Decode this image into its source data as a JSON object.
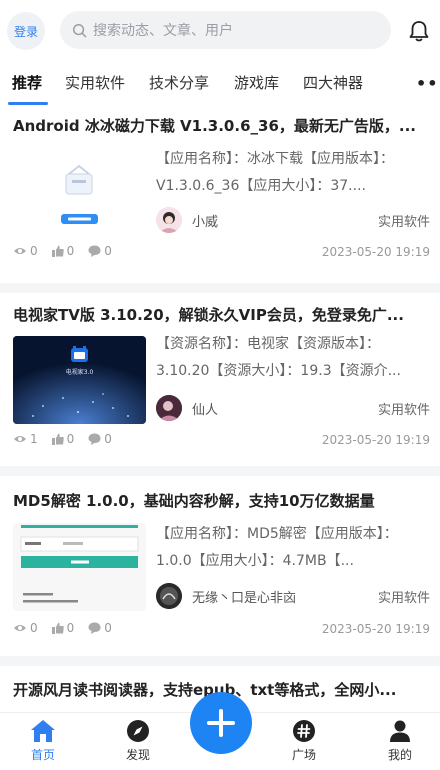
{
  "header": {
    "login_label": "登录",
    "search_placeholder": "搜索动态、文章、用户",
    "bell_icon": "bell-icon",
    "accent_color": "#2f7ff0"
  },
  "tabs": [
    {
      "label": "推荐",
      "active": true
    },
    {
      "label": "实用软件",
      "active": false
    },
    {
      "label": "技术分享",
      "active": false
    },
    {
      "label": "游戏库",
      "active": false
    },
    {
      "label": "四大神器",
      "active": false
    }
  ],
  "more_label": "•••",
  "posts": [
    {
      "title": "Android 冰冰磁力下载 V1.3.0.6_36，最新无广告版，...",
      "excerpt": "【应用名称】：冰冰下载【应用版本】：V1.3.0.6_36【应用大小】：37....",
      "author": "小威",
      "category": "实用软件",
      "views": "0",
      "likes": "0",
      "comments": "0",
      "date": "2023-05-20 19:19"
    },
    {
      "title": "电视家TV版 3.10.20，解锁永久VIP会员，免登录免广...",
      "excerpt": "【资源名称】：电视家【资源版本】：3.10.20【资源大小】：19.3【资源介...",
      "thumb_text": "电视家3.0",
      "author": "仙人",
      "category": "实用软件",
      "views": "1",
      "likes": "0",
      "comments": "0",
      "date": "2023-05-20 19:19"
    },
    {
      "title": "MD5解密 1.0.0，基础内容秒解，支持10万亿数据量",
      "excerpt": "【应用名称】：MD5解密【应用版本】：1.0.0【应用大小】：4.7MB【...",
      "author": "无缘丶口是心非㐫",
      "category": "实用软件",
      "views": "0",
      "likes": "0",
      "comments": "0",
      "date": "2023-05-20 19:19"
    },
    {
      "title": "开源风月读书阅读器，支持epub、txt等格式，全网小..."
    }
  ],
  "bottom_nav": [
    {
      "label": "首页",
      "icon": "home-icon",
      "active": true
    },
    {
      "label": "发现",
      "icon": "compass-icon",
      "active": false
    },
    {
      "label": "广场",
      "icon": "hash-icon",
      "active": false
    },
    {
      "label": "我的",
      "icon": "user-icon",
      "active": false
    }
  ],
  "fab_icon": "plus-icon"
}
